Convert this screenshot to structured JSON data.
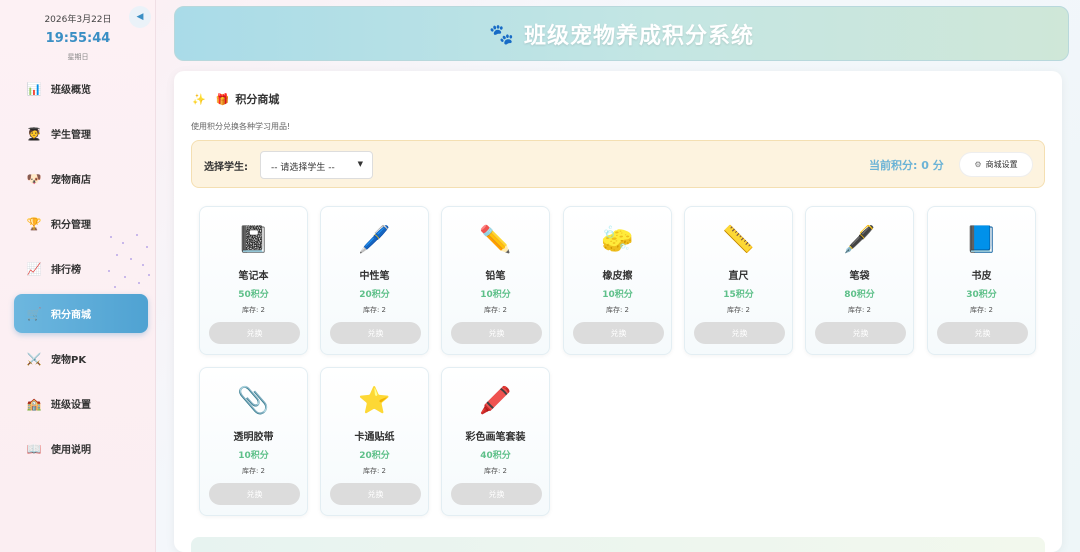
{
  "sidebar": {
    "date": "2026年3月22日",
    "time": "19:55:44",
    "weekday": "星期日",
    "collapse_icon": "◀",
    "items": [
      {
        "label": "班级概览",
        "icon": "📊"
      },
      {
        "label": "学生管理",
        "icon": "🧑‍🎓"
      },
      {
        "label": "宠物商店",
        "icon": "🐶"
      },
      {
        "label": "积分管理",
        "icon": "🏆"
      },
      {
        "label": "排行榜",
        "icon": "📈"
      },
      {
        "label": "积分商城",
        "icon": "🛒",
        "active": true
      },
      {
        "label": "宠物PK",
        "icon": "⚔️"
      },
      {
        "label": "班级设置",
        "icon": "🏫"
      },
      {
        "label": "使用说明",
        "icon": "📖"
      }
    ]
  },
  "header": {
    "icon": "🐾",
    "title": "班级宠物养成积分系统"
  },
  "shop": {
    "title_icon_1": "✨",
    "title_icon_2": "🎁",
    "title": "积分商城",
    "description": "使用积分兑换各种学习用品!",
    "select_label": "选择学生:",
    "select_value": "-- 请选择学生 --",
    "select_arrow": "▼",
    "points_label": "当前积分: 0 分",
    "settings_icon": "⚙",
    "settings_label": "商城设置",
    "products": [
      {
        "icon": "📓",
        "name": "笔记本",
        "price": "50积分",
        "stock": "库存: 2",
        "button": "兑换"
      },
      {
        "icon": "🖊️",
        "name": "中性笔",
        "price": "20积分",
        "stock": "库存: 2",
        "button": "兑换"
      },
      {
        "icon": "✏️",
        "name": "铅笔",
        "price": "10积分",
        "stock": "库存: 2",
        "button": "兑换"
      },
      {
        "icon": "🧽",
        "name": "橡皮擦",
        "price": "10积分",
        "stock": "库存: 2",
        "button": "兑换"
      },
      {
        "icon": "📏",
        "name": "直尺",
        "price": "15积分",
        "stock": "库存: 2",
        "button": "兑换"
      },
      {
        "icon": "🖋️",
        "name": "笔袋",
        "price": "80积分",
        "stock": "库存: 2",
        "button": "兑换"
      },
      {
        "icon": "📘",
        "name": "书皮",
        "price": "30积分",
        "stock": "库存: 2",
        "button": "兑换"
      },
      {
        "icon": "📎",
        "name": "透明胶带",
        "price": "10积分",
        "stock": "库存: 2",
        "button": "兑换"
      },
      {
        "icon": "⭐",
        "name": "卡通贴纸",
        "price": "20积分",
        "stock": "库存: 2",
        "button": "兑换"
      },
      {
        "icon": "🖍️",
        "name": "彩色画笔套装",
        "price": "40积分",
        "stock": "库存: 2",
        "button": "兑换"
      }
    ]
  },
  "colors": {
    "accent": "#4fa2d2",
    "price": "#5fc08a",
    "points": "#6bb3d6"
  }
}
